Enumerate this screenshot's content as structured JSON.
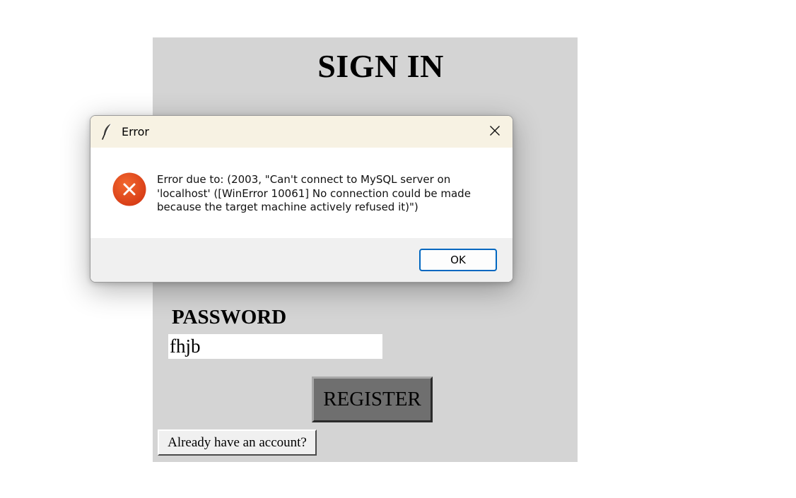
{
  "main_window": {
    "title": "SIGN IN",
    "password_label": "PASSWORD",
    "password_value": "fhjb",
    "register_label": "REGISTER",
    "login_link_label": "Already have an account?"
  },
  "dialog": {
    "title": "Error",
    "icon": "error-icon",
    "title_icon": "feather-icon",
    "message": "Error due to: (2003, \"Can't connect to MySQL server on 'localhost' ([WinError 10061] No connection could be made because the target machine actively refused it)\")",
    "ok_label": "OK",
    "accent_color": "#0067c0",
    "error_color": "#e0401a"
  }
}
